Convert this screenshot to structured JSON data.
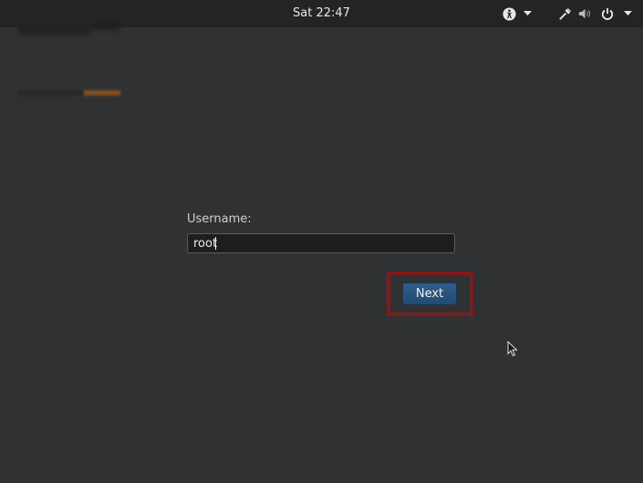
{
  "topbar": {
    "clock": "Sat 22:47",
    "icons": [
      "accessibility-icon",
      "chevron-down-icon",
      "network-icon",
      "volume-icon",
      "power-icon",
      "chevron-down-icon"
    ]
  },
  "login": {
    "username_label": "Username:",
    "username_value": "root",
    "next_label": "Next"
  },
  "colors": {
    "background": "#303133",
    "topbar": "#232426",
    "button": "#2f5d8a",
    "highlight": "#7d1c1e"
  }
}
